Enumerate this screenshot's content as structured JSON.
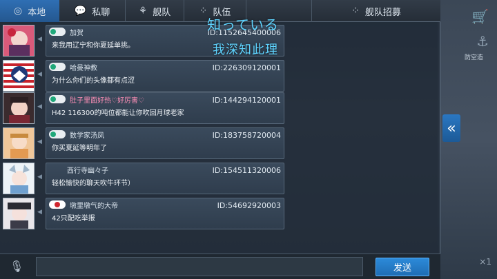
{
  "tabs": [
    {
      "label": "本地",
      "icon": "globe-icon"
    },
    {
      "label": "私聊",
      "icon": "chat-bubble-icon"
    },
    {
      "label": "舰队",
      "icon": "fleet-icon"
    },
    {
      "label": "队伍",
      "icon": "team-icon"
    },
    {
      "label": "",
      "icon": ""
    },
    {
      "label": "舰队招募",
      "icon": "recruit-icon"
    }
  ],
  "overlay": {
    "line1": "知っている",
    "line2": "我深知此理"
  },
  "messages": [
    {
      "name": "加贺",
      "uid": "ID:1152645400006",
      "text": "来我用辽宁和你夏延单挑。",
      "badge": "guild",
      "name_color": "normal"
    },
    {
      "name": "哈曼神教",
      "uid": "ID:226309120001",
      "text": "为什么你们的头像都有点涩",
      "badge": "guild",
      "name_color": "normal"
    },
    {
      "name": "肚子里面好热♡好厉害♡",
      "uid": "ID:144294120001",
      "text": "H42 116300的吨位都能让你吹回月球老家",
      "badge": "guild",
      "name_color": "pink"
    },
    {
      "name": "数学家汤凤",
      "uid": "ID:183758720004",
      "text": "你买夏延等明年了",
      "badge": "guild",
      "name_color": "normal"
    },
    {
      "name": "西行寺幽々子",
      "uid": "ID:154511320006",
      "text": "轻松愉快的聊天吹牛环节）",
      "badge": "none",
      "name_color": "normal"
    },
    {
      "name": "墩里墩气的大帝",
      "uid": "ID:54692920003",
      "text": "42只配吃举报",
      "badge": "flag",
      "name_color": "normal"
    }
  ],
  "bottom": {
    "input_placeholder": "",
    "send_label": "发送"
  },
  "right": {
    "caption": "防空造",
    "count": "×1"
  },
  "colors": {
    "accent": "#2c8ad9",
    "overlay_text": "#5fd4ff",
    "pink_name": "#ff8fb7"
  }
}
